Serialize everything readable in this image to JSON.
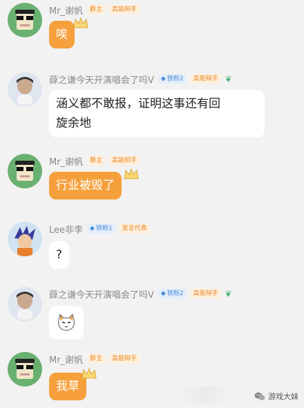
{
  "messages": [
    {
      "user": "Mr_谢帆",
      "badges": [
        "群主",
        "高能辩手"
      ],
      "text": "唉",
      "type": "orange"
    },
    {
      "user": "薛之谦今天开演唱会了吗V",
      "badges": [
        "铁粉2",
        "高能辩手"
      ],
      "text_lines": [
        "涵义都不敢报，证明这事还有回",
        "旋余地"
      ],
      "type": "white"
    },
    {
      "user": "Mr_谢帆",
      "badges": [
        "群主",
        "高能辩手"
      ],
      "text": "行业被毁了",
      "type": "orange"
    },
    {
      "user": "Lee非李",
      "badges": [
        "铁粉1",
        "发言代表"
      ],
      "text": "?",
      "type": "white"
    },
    {
      "user": "薛之谦今天开演唱会了吗V",
      "badges": [
        "铁粉2",
        "高能辩手"
      ],
      "text": "",
      "type": "white",
      "sticker": "cat-sticker"
    },
    {
      "user": "Mr_谢帆",
      "badges": [
        "群主",
        "高能辩手"
      ],
      "text": "我草",
      "type": "orange"
    }
  ],
  "watermark": "游戏大妹",
  "colors": {
    "orange": "#f5a03c",
    "bg": "#f2f2f2",
    "blue": "#4a8cd8",
    "green": "#4bb27c"
  }
}
